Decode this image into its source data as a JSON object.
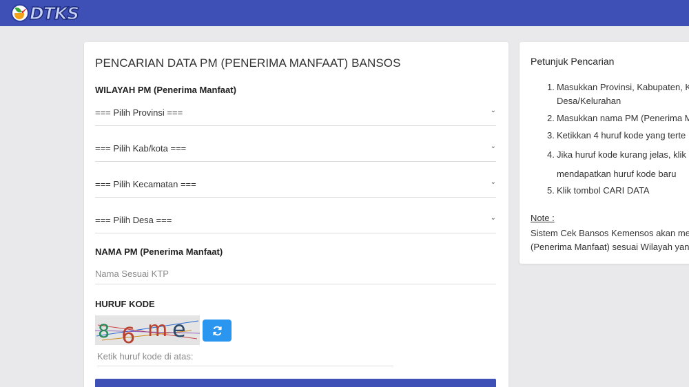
{
  "header": {
    "logo_text": "DTKS",
    "brand_color": "#3e4fb5"
  },
  "main": {
    "title": "PENCARIAN DATA PM (PENERIMA MANFAAT) BANSOS",
    "wilayah_label": "WILAYAH PM (Penerima Manfaat)",
    "selects": [
      {
        "value": "=== Pilih Provinsi ==="
      },
      {
        "value": "=== Pilih Kab/kota ==="
      },
      {
        "value": "=== Pilih Kecamatan ==="
      },
      {
        "value": "=== Pilih Desa ==="
      }
    ],
    "nama_label": "NAMA PM (Penerima Manfaat)",
    "nama_placeholder": "Nama Sesuai KTP",
    "kode_label": "HURUF KODE",
    "captcha_text": "86me",
    "kode_placeholder": "Ketik huruf kode di atas:"
  },
  "side": {
    "title": "Petunjuk Pencarian",
    "steps": [
      {
        "num": "1.",
        "line1": "Masukkan Provinsi, Kabupaten, K",
        "line2": "Desa/Kelurahan"
      },
      {
        "num": "2.",
        "line1": "Masukkan nama PM (Penerima M"
      },
      {
        "num": "3.",
        "line1": "Ketikkan 4 huruf kode yang terte"
      },
      {
        "num": "4.",
        "line1": "Jika huruf kode kurang jelas, klik",
        "line2": "mendapatkan huruf kode baru"
      },
      {
        "num": "5.",
        "line1": "Klik tombol CARI DATA"
      }
    ],
    "note_label": "Note :",
    "note_line1": "Sistem Cek Bansos Kemensos akan mer",
    "note_line2": "(Penerima Manfaat) sesuai Wilayah yang"
  },
  "icons": {
    "refresh": "refresh-icon",
    "chevron": "chevron-down-icon"
  }
}
